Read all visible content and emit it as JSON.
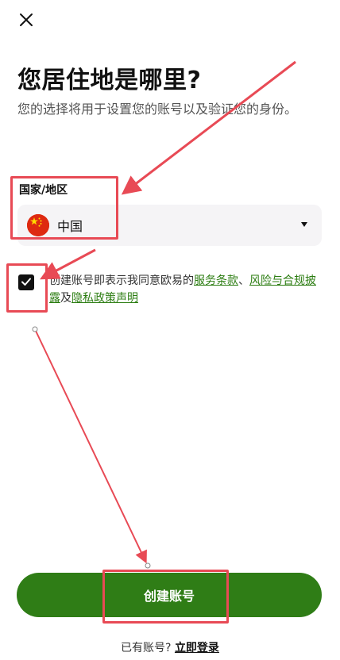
{
  "header": {
    "close_icon": "close-icon"
  },
  "page": {
    "title": "您居住地是哪里?",
    "subtitle": "您的选择将用于设置您的账号以及验证您的身份。"
  },
  "country_field": {
    "label": "国家/地区",
    "selected": "中国",
    "flag_icon": "china-flag-icon",
    "dropdown_icon": "caret-down-icon"
  },
  "agreement": {
    "checked": true,
    "prefix": "创建账号即表示我同意欧易的",
    "terms_link": "服务条款",
    "sep1": "、",
    "risk_link": "风险与合规披露",
    "sep2": "及",
    "privacy_link": "隐私政策声明"
  },
  "actions": {
    "create_label": "创建账号",
    "login_prompt": "已有账号?",
    "login_link": "立即登录"
  },
  "colors": {
    "accent": "#2f7d16",
    "link": "#2c7d12",
    "annotation": "#e84a55"
  }
}
